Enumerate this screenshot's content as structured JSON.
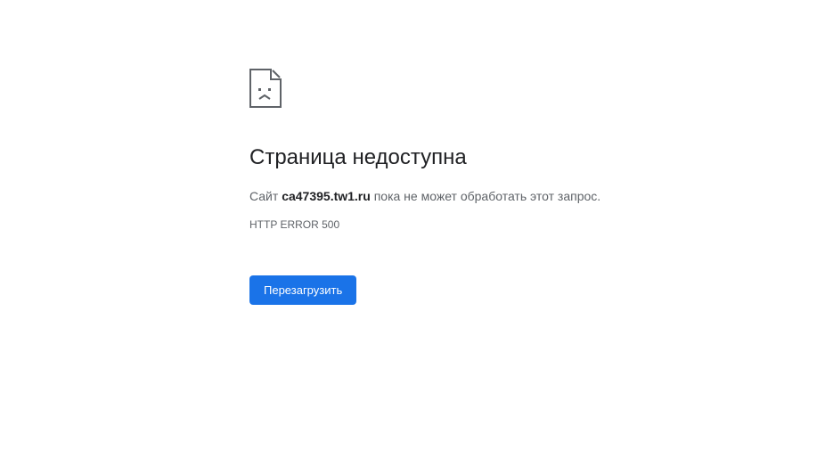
{
  "error": {
    "title": "Страница недоступна",
    "message_prefix": "Сайт ",
    "site": "ca47395.tw1.ru",
    "message_suffix": " пока не может обработать этот запрос.",
    "code": "HTTP ERROR 500",
    "reload_label": "Перезагрузить"
  }
}
